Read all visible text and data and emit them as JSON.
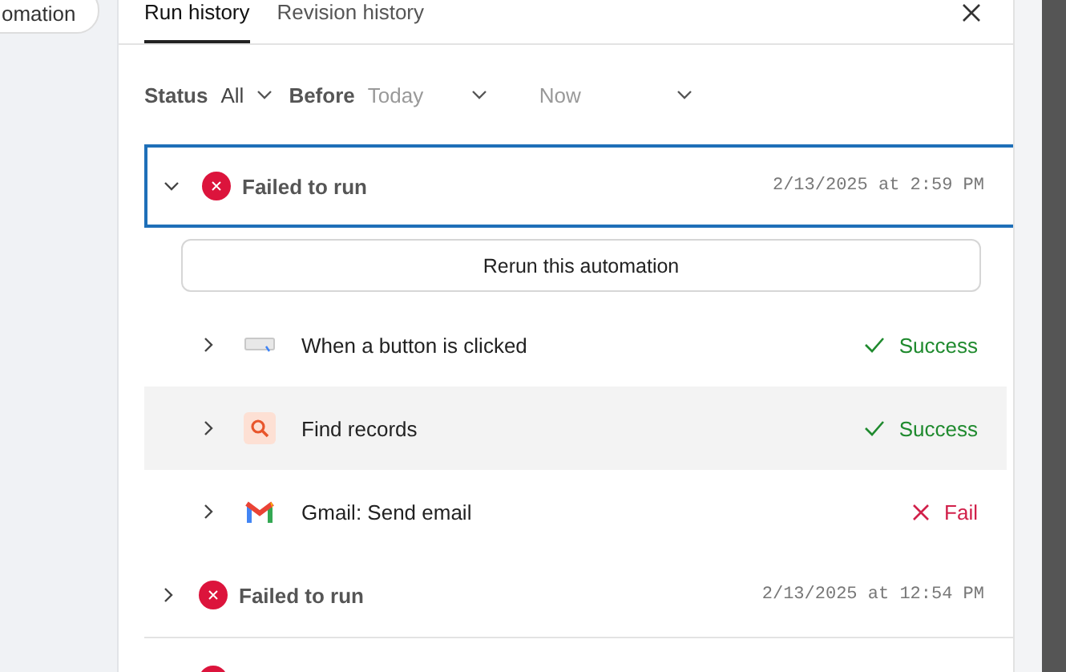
{
  "left_button": {
    "label": "omation"
  },
  "tabs": [
    {
      "label": "Run history",
      "selected": true
    },
    {
      "label": "Revision history",
      "selected": false
    }
  ],
  "filters": [
    {
      "label": "Status",
      "value": "All",
      "placeholder": false
    },
    {
      "label": "Before",
      "value": "Today",
      "placeholder": true
    },
    {
      "value": "Now",
      "placeholder": true
    }
  ],
  "runs": [
    {
      "kind": "failed",
      "title": "Failed to run",
      "time": "2/13/2025 at 2:59 PM",
      "expanded": true,
      "selected": true,
      "rerun_button": "Rerun this automation",
      "steps": [
        {
          "kind": "button",
          "name": "When a button is clicked",
          "success": true,
          "result_label": "Success",
          "highlighted": false
        },
        {
          "kind": "find",
          "name": "Find records",
          "success": true,
          "result_label": "Success",
          "highlighted": true
        },
        {
          "kind": "gmail",
          "name": "Gmail: Send email",
          "success": false,
          "result_label": "Fail",
          "highlighted": false
        }
      ]
    },
    {
      "kind": "failed",
      "title": "Failed to run",
      "time": "2/13/2025 at 12:54 PM",
      "expanded": false,
      "selected": false
    },
    {
      "kind": "failed",
      "expanded": false,
      "selected": false
    }
  ]
}
